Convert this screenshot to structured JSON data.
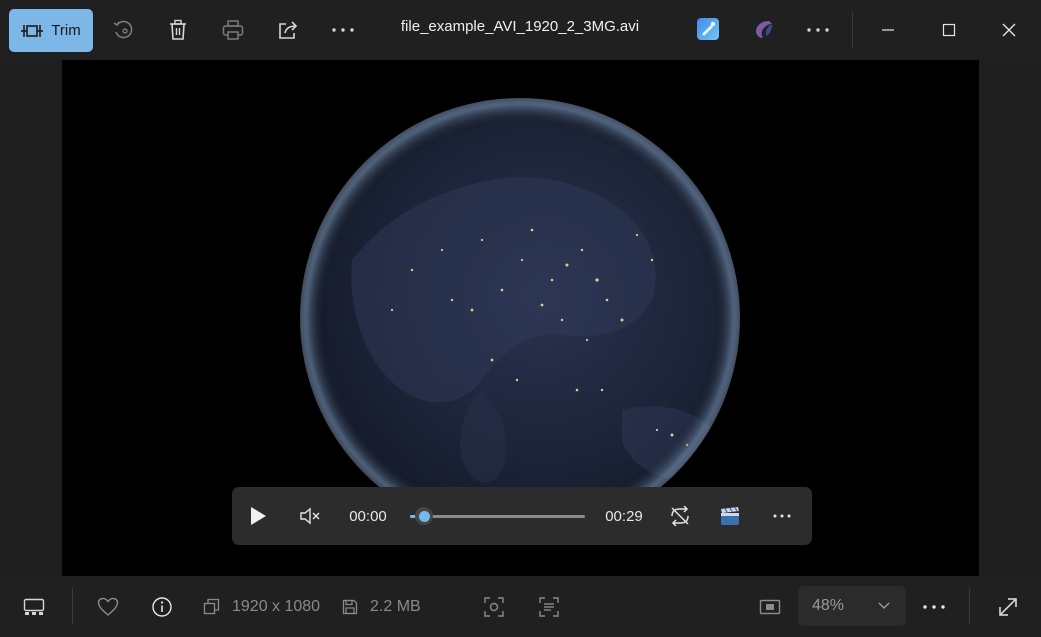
{
  "toolbar": {
    "trim_label": "Trim",
    "file_title": "file_example_AVI_1920_2_3MG.avi",
    "icons": [
      "trim-icon",
      "rotate-icon",
      "delete-icon",
      "print-icon",
      "share-icon",
      "more-icon",
      "edit-app-icon",
      "clipchamp-icon",
      "more-icon",
      "minimize-icon",
      "maximize-icon",
      "close-icon"
    ]
  },
  "player": {
    "current_time": "00:00",
    "duration": "00:29",
    "progress": 0.08,
    "muted": true,
    "playing": false
  },
  "info": {
    "dimensions": "1920 x 1080",
    "file_size": "2.2 MB",
    "zoom": "48%"
  },
  "colors": {
    "accent": "#7cb7e8",
    "seek": "#76b9ed",
    "background": "#202020"
  }
}
